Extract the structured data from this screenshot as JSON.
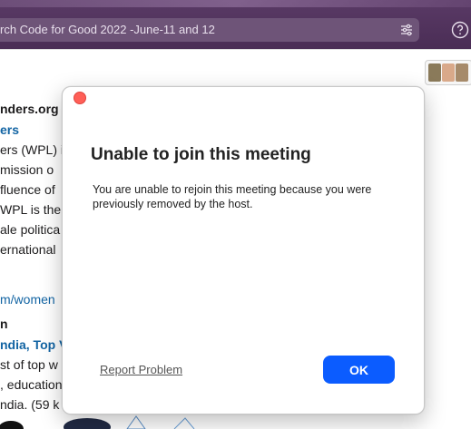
{
  "search": {
    "text": "rch Code for Good 2022 -June-11 and 12"
  },
  "background": {
    "lines": [
      {
        "text": "nders.org",
        "style": "bold"
      },
      {
        "text": "ers",
        "style": "linkbold"
      },
      {
        "text": "ers (WPL) i",
        "style": "plain"
      },
      {
        "text": " mission o",
        "style": "plain"
      },
      {
        "text": "fluence of",
        "style": "plain"
      },
      {
        "text": "WPL is the",
        "style": "plain"
      },
      {
        "text": "ale politica",
        "style": "plain"
      },
      {
        "text": "ernational",
        "style": "plain"
      },
      {
        "text": "m/women",
        "style": "link"
      },
      {
        "text": "n",
        "style": "bold"
      },
      {
        "text": "ndia, Top V",
        "style": "linkbold"
      },
      {
        "text": "st of top w",
        "style": "plain"
      },
      {
        "text": ", education",
        "style": "plain"
      },
      {
        "text": "ndia. (59 k",
        "style": "plain"
      }
    ]
  },
  "modal": {
    "title": "Unable to join this meeting",
    "message": "You are unable to rejoin this meeting because you were previously removed by the host.",
    "report_label": "Report Problem",
    "ok_label": "OK"
  },
  "colors": {
    "topbar": "#4a2d55",
    "accent": "#0b5cff",
    "close": "#ff5f57",
    "link": "#1264a3"
  }
}
